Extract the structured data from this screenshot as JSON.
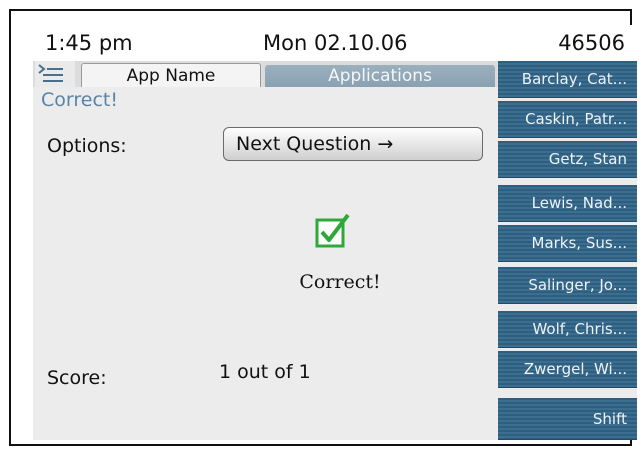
{
  "status": {
    "time": "1:45 pm",
    "date": "Mon  02.10.06",
    "extension": "46506"
  },
  "tabs": [
    {
      "label": "App Name",
      "active": true
    },
    {
      "label": "Applications",
      "active": false
    }
  ],
  "main": {
    "message": "Correct!",
    "options_label": "Options:",
    "next_button": "Next Question  →",
    "result_text": "Correct!",
    "score_label": "Score:",
    "score_value": "1 out of 1"
  },
  "sidebar": {
    "items": [
      {
        "label": "Barclay, Cat..."
      },
      {
        "label": "Caskin, Patr..."
      },
      {
        "label": "Getz, Stan"
      },
      {
        "label": "Lewis, Nad..."
      },
      {
        "label": "Marks, Sus..."
      },
      {
        "label": "Salinger, Jo..."
      },
      {
        "label": "Wolf, Chris..."
      },
      {
        "label": "Zwergel, Wi..."
      },
      {
        "label": "Shift"
      }
    ]
  },
  "colors": {
    "sidebar": "#3b6e90",
    "accent_text": "#5a84a6",
    "check_green": "#2fa83a"
  }
}
